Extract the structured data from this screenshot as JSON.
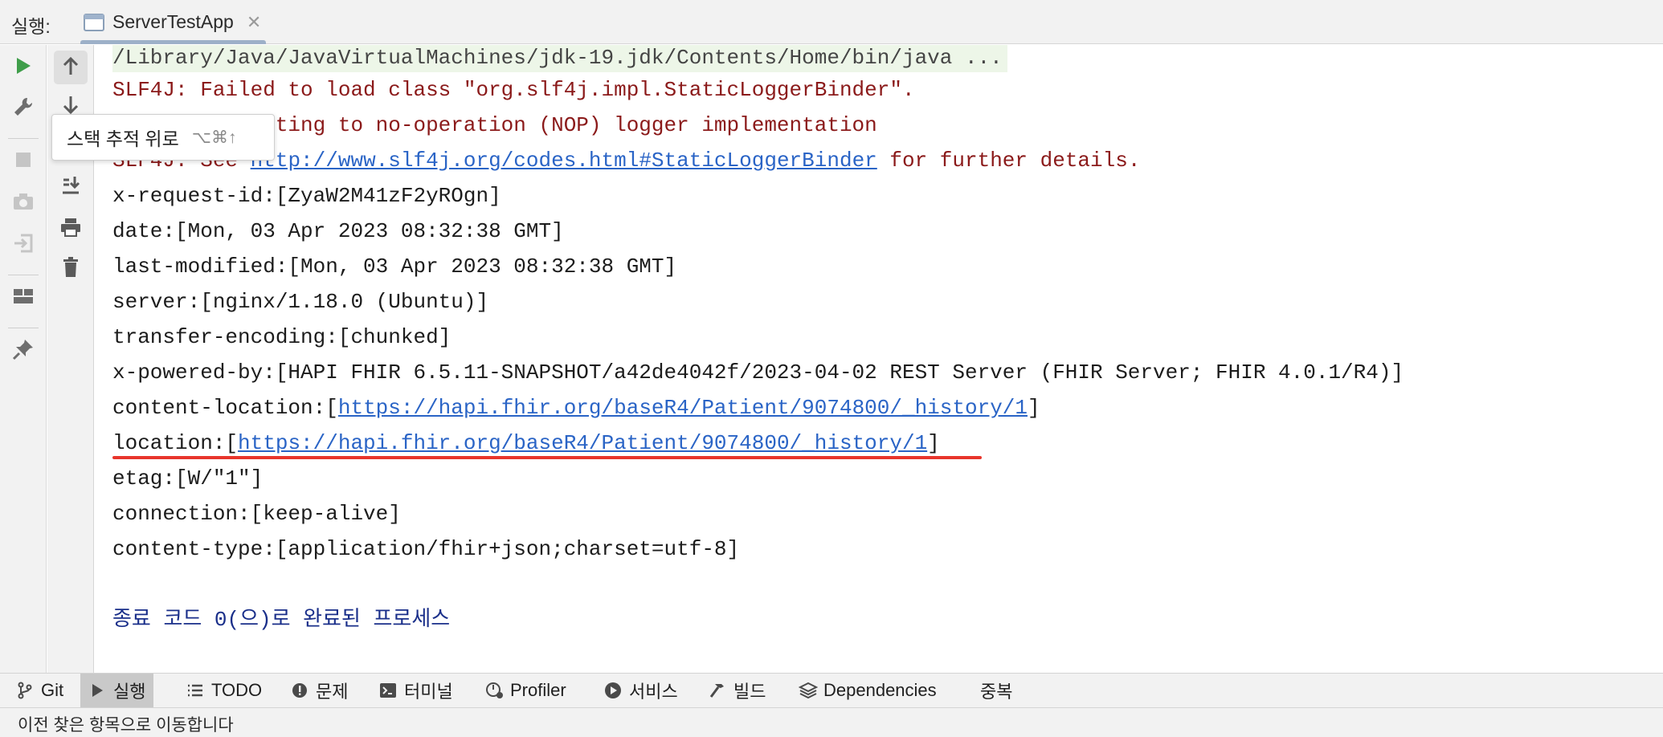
{
  "topbar": {
    "run_label": "실행:",
    "tab_title": "ServerTestApp",
    "tab_close": "✕"
  },
  "tooltip": {
    "text": "스택 추적 위로",
    "shortcut": "⌥⌘↑"
  },
  "console": {
    "cmd_line": "/Library/Java/JavaVirtualMachines/jdk-19.jdk/Contents/Home/bin/java ...",
    "err1": "SLF4J: Failed to load class \"org.slf4j.impl.StaticLoggerBinder\".",
    "err2": "SLF4J: Defaulting to no-operation (NOP) logger implementation",
    "err3_prefix": "SLF4J: See ",
    "err3_link": "http://www.slf4j.org/codes.html#StaticLoggerBinder",
    "err3_suffix": " for further details.",
    "headers": [
      "x-request-id:[ZyaW2M41zF2yROgn]",
      "date:[Mon, 03 Apr 2023 08:32:38 GMT]",
      "last-modified:[Mon, 03 Apr 2023 08:32:38 GMT]",
      "server:[nginx/1.18.0 (Ubuntu)]",
      "transfer-encoding:[chunked]",
      "x-powered-by:[HAPI FHIR 6.5.11-SNAPSHOT/a42de4042f/2023-04-02 REST Server (FHIR Server; FHIR 4.0.1/R4)]"
    ],
    "content_location_prefix": "content-location:[",
    "content_location_link": "https://hapi.fhir.org/baseR4/Patient/9074800/_history/1",
    "content_location_suffix": "]",
    "location_prefix": "location:[",
    "location_link": "https://hapi.fhir.org/baseR4/Patient/9074800/_history/1",
    "location_suffix": "]",
    "headers2": [
      "etag:[W/\"1\"]",
      "connection:[keep-alive]",
      "content-type:[application/fhir+json;charset=utf-8]"
    ],
    "exit_message": "종료 코드 0(으)로 완료된 프로세스"
  },
  "bottombar": {
    "items": [
      {
        "label": "Git",
        "icon": "git-branch-icon"
      },
      {
        "label": "실행",
        "icon": "run-icon"
      },
      {
        "label": "TODO",
        "icon": "list-icon"
      },
      {
        "label": "문제",
        "icon": "problems-icon"
      },
      {
        "label": "터미널",
        "icon": "terminal-icon"
      },
      {
        "label": "Profiler",
        "icon": "profiler-icon"
      },
      {
        "label": "서비스",
        "icon": "services-icon"
      },
      {
        "label": "빌드",
        "icon": "hammer-icon"
      },
      {
        "label": "Dependencies",
        "icon": "layers-icon"
      },
      {
        "label": "중복",
        "icon": ""
      }
    ]
  },
  "status": {
    "text": "이전 찾은 항목으로 이동합니다"
  },
  "colors": {
    "error_text": "#8b1a1a",
    "link": "#2a64c6",
    "exit_text": "#1a2f8a",
    "run_green": "#3f9e4a",
    "highlight_underline": "#e8352c"
  }
}
